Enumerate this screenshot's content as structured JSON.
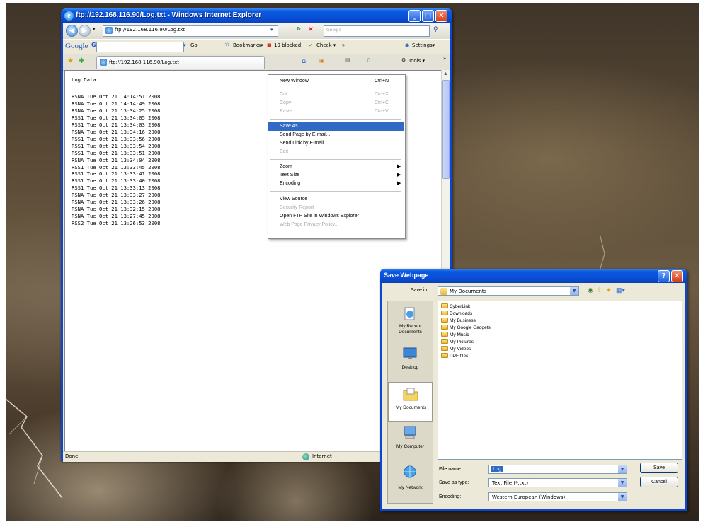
{
  "ie": {
    "title": "ftp://192.168.116.90/Log.txt - Windows Internet Explorer",
    "address": "ftp://192.168.116.90/Log.txt",
    "search_placeholder": "Google",
    "tab_label": "ftp://192.168.116.90/Log.txt",
    "google_toolbar": {
      "logo": "Google",
      "search_btn": "G▾",
      "go": "Go",
      "bookmarks": "Bookmarks▾",
      "blocked": "19 blocked",
      "check": "Check ▾",
      "more": "»",
      "settings": "Settings▾"
    },
    "tools_label": "Tools ▾",
    "more_chevron": "»",
    "status_text": "Done",
    "zone_text": "Internet"
  },
  "log": {
    "heading": "Log Data",
    "lines": [
      "RSNA Tue Oct 21 14:14:51 2008",
      "RSNA Tue Oct 21 14:14:49 2008",
      "RSNA Tue Oct 21 13:34:25 2008",
      "RSS1 Tue Oct 21 13:34:05 2008",
      "RSS1 Tue Oct 21 13:34:03 2008",
      "RSNA Tue Oct 21 13:34:16 2008",
      "RSS1 Tue Oct 21 13:33:56 2008",
      "RSS1 Tue Oct 21 13:33:54 2008",
      "RSS1 Tue Oct 21 13:33:51 2008",
      "RSNA Tue Oct 21 13:34:04 2008",
      "RSS1 Tue Oct 21 13:33:45 2008",
      "RSS1 Tue Oct 21 13:33:41 2008",
      "RSS1 Tue Oct 21 13:33:40 2008",
      "RSS1 Tue Oct 21 13:33:13 2008",
      "RSNA Tue Oct 21 13:33:27 2008",
      "RSNA Tue Oct 21 13:33:26 2008",
      "RSNA Tue Oct 21 13:32:15 2008",
      "RSNA Tue Oct 21 13:27:45 2008",
      "RSS2 Tue Oct 21 13:26:53 2008"
    ]
  },
  "menu": {
    "new_window": "New Window",
    "new_window_key": "Ctrl+N",
    "cut": "Cut",
    "cut_key": "Ctrl+X",
    "copy": "Copy",
    "copy_key": "Ctrl+C",
    "paste": "Paste",
    "paste_key": "Ctrl+V",
    "save_as": "Save As...",
    "send_page": "Send Page by E-mail...",
    "send_link": "Send Link by E-mail...",
    "edit": "Edit",
    "zoom": "Zoom",
    "text_size": "Text Size",
    "encoding": "Encoding",
    "view_source": "View Source",
    "security_report": "Security Report",
    "open_ftp": "Open FTP Site in Windows Explorer",
    "privacy": "Web Page Privacy Policy..."
  },
  "dialog": {
    "title": "Save Webpage",
    "save_in_label": "Save in:",
    "save_in_value": "My Documents",
    "places": [
      "My Recent Documents",
      "Desktop",
      "My Documents",
      "My Computer",
      "My Network"
    ],
    "files": [
      "CyberLink",
      "Downloads",
      "My Business",
      "My Google Gadgets",
      "My Music",
      "My Pictures",
      "My Videos",
      "PDF files"
    ],
    "file_name_label": "File name:",
    "file_name_value": "Log",
    "save_type_label": "Save as type:",
    "save_type_value": "Text File (*.txt)",
    "encoding_label": "Encoding:",
    "encoding_value": "Western European (Windows)",
    "save_button": "Save",
    "cancel_button": "Cancel",
    "help": "?",
    "close": "✕"
  }
}
